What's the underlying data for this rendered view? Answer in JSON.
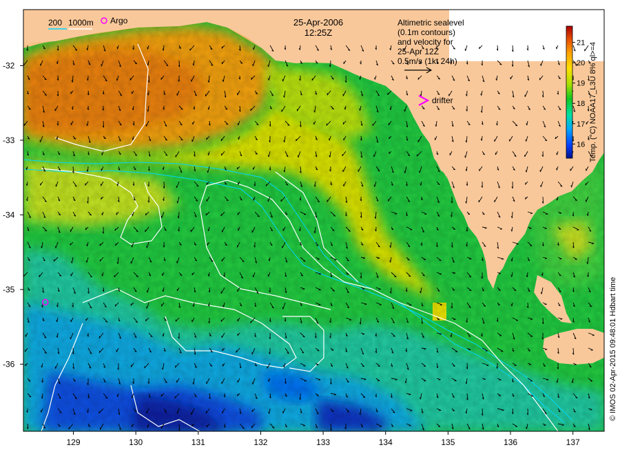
{
  "title": {
    "date": "25-Apr-2006",
    "time": "12:25Z"
  },
  "depth_legend": {
    "label_200": "200",
    "label_1000": "1000m",
    "argo_label": "Argo"
  },
  "info_box": {
    "lines": [
      "Altimetric sealevel",
      "(0.1m contours)",
      "and velocity for",
      "25-Apr 12Z",
      "0.5m/s (1kt 24h)"
    ]
  },
  "drifter_label": "drifter",
  "colorbar": {
    "title": "Temp. (°C) NOAA17_L3U 8% ql>=4",
    "ticks": [
      16,
      17,
      18,
      19,
      20,
      21
    ],
    "range": [
      15.3,
      21.8
    ],
    "colors": [
      "#00108a",
      "#0040ff",
      "#00a8ff",
      "#00e0a0",
      "#10c820",
      "#a8e000",
      "#ffe000",
      "#ffa000",
      "#e85000",
      "#a80000"
    ]
  },
  "axes": {
    "x_ticks": [
      129,
      130,
      131,
      132,
      133,
      134,
      135,
      136,
      137
    ],
    "y_ticks": [
      -32,
      -33,
      -34,
      -35,
      -36
    ],
    "x_range": [
      128.2,
      137.5
    ],
    "y_range": [
      -36.9,
      -31.25
    ]
  },
  "credit": "© IMOS 02-Apr-2015 09:48:01 Hdbart time",
  "colors": {
    "land": "#f9c89a",
    "arrow": "#000000",
    "contour": "#ffffff",
    "bathymetry": "#00d8ff",
    "argo_marker": "#ff00ff"
  },
  "argo_floats": [
    {
      "lon": 128.55,
      "lat": -35.17
    }
  ]
}
